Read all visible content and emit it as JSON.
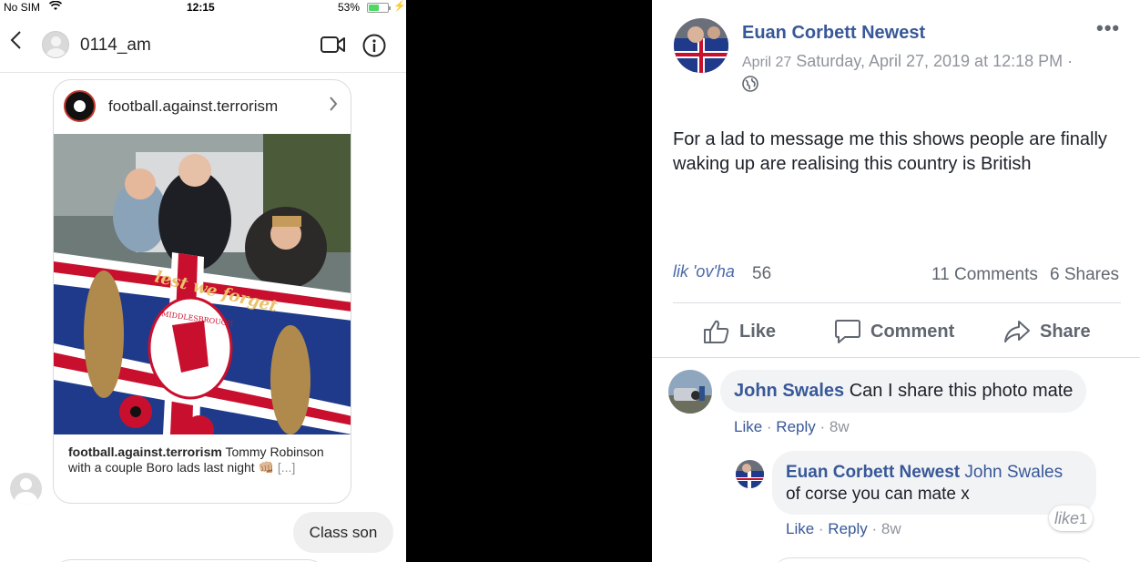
{
  "status_bar": {
    "carrier": "No SIM",
    "time": "12:15",
    "battery_percent": "53%",
    "battery_level": 0.53
  },
  "instagram": {
    "header": {
      "username": "0114_am"
    },
    "shared_post": {
      "account": "football.against.terrorism",
      "caption_account": "football.against.terrorism",
      "caption_text": " Tommy Robinson with a couple Boro lads last night 👊🏼 ",
      "more": "[...]",
      "photo_text": "lest we forget",
      "photo_crest": "MIDDLESBROUGH"
    },
    "reply_bubble": "Class son"
  },
  "facebook": {
    "author": "Euan Corbett Newest",
    "date_short": "April 27",
    "date_full": "Saturday, April 27, 2019 at 12:18 PM",
    "date_sep": "·",
    "body": "For a lad to message me this shows people are finally waking up are realising this country is British",
    "reactions_alt": "lik 'ov'ha",
    "reactions_count": "56",
    "comments_count": "11 Comments",
    "shares_count": "6 Shares",
    "actions": {
      "like": "Like",
      "comment": "Comment",
      "share": "Share"
    },
    "comments": [
      {
        "author": "John Swales",
        "text": "Can I share this photo mate",
        "like": "Like",
        "reply": "Reply",
        "age": "8w"
      },
      {
        "author": "Euan Corbett Newest",
        "reply_to": "John Swales",
        "text": "of corse you can mate x",
        "like": "Like",
        "reply": "Reply",
        "age": "8w",
        "like_badge_alt": "like",
        "like_badge_count": "1"
      }
    ]
  },
  "colors": {
    "fb_link": "#385898",
    "fb_grey": "#606770",
    "ig_bubble": "#efefef"
  }
}
